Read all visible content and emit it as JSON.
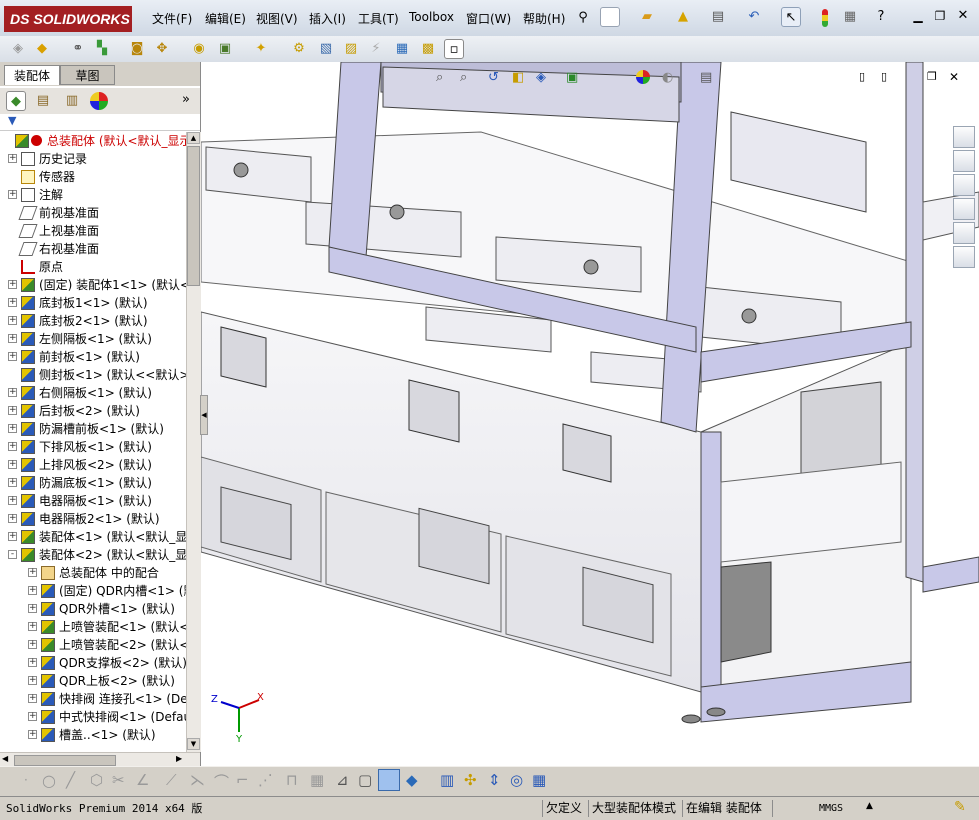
{
  "app": {
    "logo": "DS SOLIDWORKS",
    "menu": [
      "文件(F)",
      "编辑(E)",
      "视图(V)",
      "插入(I)",
      "工具(T)",
      "Toolbox",
      "窗口(W)",
      "帮助(H)"
    ]
  },
  "left_panel": {
    "tabs": [
      "装配体",
      "草图"
    ],
    "tree": [
      {
        "label": "总装配体  (默认<默认_显示",
        "icon": "assembly-icon",
        "expander": "",
        "indent": 0,
        "warning": true
      },
      {
        "label": "历史记录",
        "icon": "history-icon",
        "expander": "+",
        "indent": 1
      },
      {
        "label": "传感器",
        "icon": "sensor-icon",
        "expander": "",
        "indent": 1
      },
      {
        "label": "注解",
        "icon": "annotation-icon",
        "expander": "+",
        "indent": 1
      },
      {
        "label": "前视基准面",
        "icon": "plane-icon",
        "expander": "",
        "indent": 1
      },
      {
        "label": "上视基准面",
        "icon": "plane-icon",
        "expander": "",
        "indent": 1
      },
      {
        "label": "右视基准面",
        "icon": "plane-icon",
        "expander": "",
        "indent": 1
      },
      {
        "label": "原点",
        "icon": "origin-icon",
        "expander": "",
        "indent": 1
      },
      {
        "label": "(固定) 装配体1<1> (默认<",
        "icon": "subassembly-icon",
        "expander": "+",
        "indent": 1
      },
      {
        "label": "底封板1<1> (默认)",
        "icon": "part-icon",
        "expander": "+",
        "indent": 1
      },
      {
        "label": "底封板2<1> (默认)",
        "icon": "part-icon",
        "expander": "+",
        "indent": 1
      },
      {
        "label": "左侧隔板<1> (默认)",
        "icon": "part-icon",
        "expander": "+",
        "indent": 1
      },
      {
        "label": "前封板<1> (默认)",
        "icon": "part-icon",
        "expander": "+",
        "indent": 1
      },
      {
        "label": "侧封板<1> (默认<<默认>_显",
        "icon": "part-icon",
        "expander": "",
        "indent": 1
      },
      {
        "label": "右侧隔板<1> (默认)",
        "icon": "part-icon",
        "expander": "+",
        "indent": 1
      },
      {
        "label": "后封板<2> (默认)",
        "icon": "part-icon",
        "expander": "+",
        "indent": 1
      },
      {
        "label": "防漏槽前板<1> (默认)",
        "icon": "part-icon",
        "expander": "+",
        "indent": 1
      },
      {
        "label": "下排风板<1> (默认)",
        "icon": "part-icon",
        "expander": "+",
        "indent": 1
      },
      {
        "label": "上排风板<2> (默认)",
        "icon": "part-icon",
        "expander": "+",
        "indent": 1
      },
      {
        "label": "防漏底板<1> (默认)",
        "icon": "part-icon",
        "expander": "+",
        "indent": 1
      },
      {
        "label": "电器隔板<1> (默认)",
        "icon": "part-icon",
        "expander": "+",
        "indent": 1
      },
      {
        "label": "电器隔板2<1> (默认)",
        "icon": "part-icon",
        "expander": "+",
        "indent": 1
      },
      {
        "label": "装配体<1> (默认<默认_显",
        "icon": "subassembly-icon",
        "expander": "+",
        "indent": 1
      },
      {
        "label": "装配体<2> (默认<默认_显",
        "icon": "subassembly-icon",
        "expander": "-",
        "indent": 1
      },
      {
        "label": "总装配体 中的配合",
        "icon": "mates-icon",
        "expander": "+",
        "indent": 2
      },
      {
        "label": "(固定) QDR内槽<1> (默",
        "icon": "part-icon",
        "expander": "+",
        "indent": 2
      },
      {
        "label": "QDR外槽<1> (默认)",
        "icon": "part-icon",
        "expander": "+",
        "indent": 2
      },
      {
        "label": "上喷管装配<1> (默认<",
        "icon": "subassembly-icon",
        "expander": "+",
        "indent": 2
      },
      {
        "label": "上喷管装配<2> (默认<",
        "icon": "subassembly-icon",
        "expander": "+",
        "indent": 2
      },
      {
        "label": "QDR支撑板<2> (默认)",
        "icon": "part-icon",
        "expander": "+",
        "indent": 2
      },
      {
        "label": "QDR上板<2> (默认)",
        "icon": "part-icon",
        "expander": "+",
        "indent": 2
      },
      {
        "label": "快排阀 连接孔<1> (De",
        "icon": "part-icon",
        "expander": "+",
        "indent": 2
      },
      {
        "label": "中式快排阀<1> (Defau",
        "icon": "part-icon",
        "expander": "+",
        "indent": 2
      },
      {
        "label": "槽盖..<1> (默认)",
        "icon": "part-icon",
        "expander": "+",
        "indent": 2
      }
    ]
  },
  "viewport": {
    "triad": {
      "x": "X",
      "y": "Y",
      "z": "Z"
    }
  },
  "status": {
    "product": "SolidWorks Premium 2014 x64 版",
    "underdefined": "欠定义",
    "large_assembly": "大型装配体模式",
    "editing": "在编辑 装配体",
    "units": "MMGS"
  },
  "colors": {
    "warning": "#cc0000",
    "frame": "#c8c8e8",
    "accent": "#a31f22"
  }
}
